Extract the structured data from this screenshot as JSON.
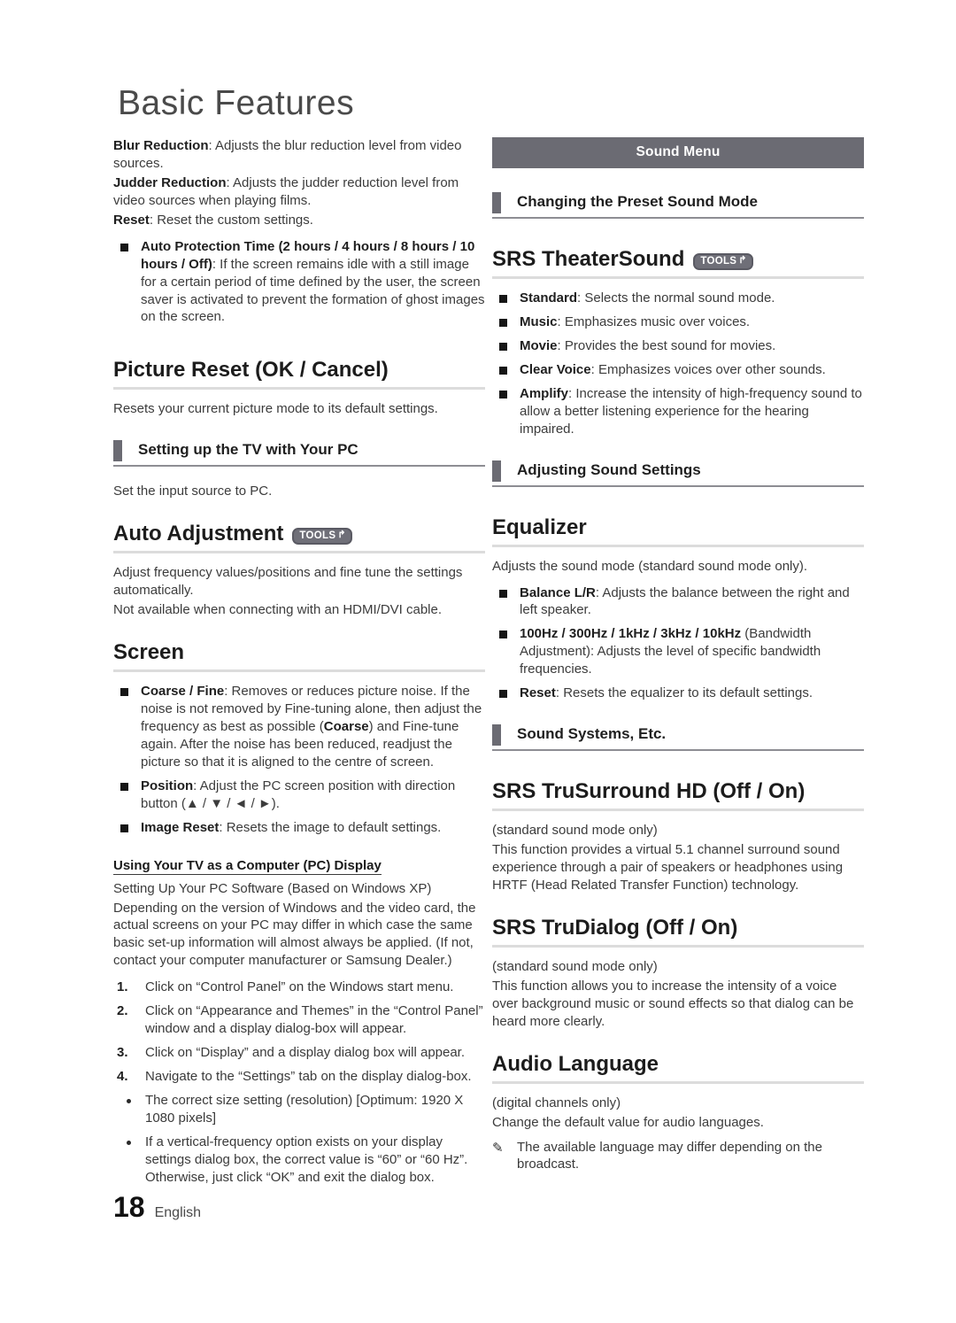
{
  "page": {
    "title": "Basic Features",
    "number": "18",
    "language": "English"
  },
  "badges": {
    "tools_label": "TOOLS",
    "tools_glyph": "↱"
  },
  "left_column": {
    "intro_paragraphs": [
      {
        "term": "Blur Reduction",
        "text": ": Adjusts the blur reduction level from video sources."
      },
      {
        "term": "Judder Reduction",
        "text": ": Adjusts the judder reduction level from video sources when playing films."
      },
      {
        "term": "Reset",
        "text": ": Reset the custom settings."
      }
    ],
    "auto_protection_bullet": {
      "term": "Auto Protection Time (2 hours / 4 hours / 8 hours / 10 hours / Off)",
      "text": ":  If the screen remains idle with a still image for a certain period of time defined by the user, the screen saver is activated to prevent the formation of ghost images on the screen."
    },
    "picture_reset": {
      "heading": "Picture Reset (OK / Cancel)",
      "body": "Resets your current picture mode to its default settings."
    },
    "setting_up_pc": {
      "subhead": "Setting up the TV with Your PC",
      "body": "Set the input source to PC."
    },
    "auto_adjustment": {
      "heading": "Auto Adjustment",
      "body1": "Adjust frequency values/positions and fine tune the settings automatically.",
      "body2": "Not available when connecting with an HDMI/DVI cable."
    },
    "screen": {
      "heading": "Screen",
      "bullets": [
        {
          "term": "Coarse / Fine",
          "text": ": Removes or reduces picture noise. If the noise is not removed by Fine-tuning alone, then adjust the frequency as best as possible (",
          "term2": "Coarse",
          "text2": ") and Fine-tune again. After the noise has been reduced, readjust the picture so that it is aligned to the centre of screen."
        },
        {
          "term": "Position",
          "text": ": Adjust the PC screen position with direction button (▲ / ▼ / ◄ / ►)."
        },
        {
          "term": "Image Reset",
          "text": ": Resets the image to default settings."
        }
      ]
    },
    "pc_display": {
      "underlined_heading": "Using Your TV as a Computer (PC) Display",
      "para1": "Setting Up Your PC Software (Based on Windows XP)",
      "para2": "Depending on the version of Windows and the video card, the actual screens on your PC may differ in which case the same basic set-up information will almost always be applied. (If not, contact your computer manufacturer or Samsung Dealer.)",
      "steps": [
        "Click on “Control Panel” on the Windows start menu.",
        "Click on “Appearance and Themes” in the “Control Panel” window and a display dialog-box will appear.",
        "Click on “Display” and a display dialog box will appear.",
        "Navigate to the “Settings” tab on the display dialog-box."
      ],
      "dots": [
        "The correct size setting (resolution) [Optimum: 1920 X 1080 pixels]",
        "If a vertical-frequency option exists on your display settings dialog box, the correct value is “60” or “60 Hz”. Otherwise, just click “OK” and exit the dialog box."
      ]
    }
  },
  "right_column": {
    "menu_banner": "Sound Menu",
    "preset_sound_mode": {
      "subhead": "Changing the Preset Sound Mode"
    },
    "srs_theatersound": {
      "heading": "SRS TheaterSound",
      "bullets": [
        {
          "term": "Standard",
          "text": ": Selects the normal sound mode."
        },
        {
          "term": "Music",
          "text": ": Emphasizes music over voices."
        },
        {
          "term": "Movie",
          "text": ": Provides the best sound for movies."
        },
        {
          "term": "Clear Voice",
          "text": ": Emphasizes voices over other sounds."
        },
        {
          "term": "Amplify",
          "text": ": Increase the intensity of high-frequency sound to allow a better listening experience for the hearing impaired."
        }
      ]
    },
    "adjusting_sound_settings": {
      "subhead": "Adjusting Sound Settings"
    },
    "equalizer": {
      "heading": "Equalizer",
      "body": "Adjusts the sound mode (standard sound mode only).",
      "bullets": [
        {
          "term": "Balance L/R",
          "text": ": Adjusts the balance between the right and left speaker."
        },
        {
          "term": "100Hz / 300Hz / 1kHz / 3kHz / 10kHz",
          "text": " (Bandwidth Adjustment): Adjusts the level of specific bandwidth frequencies."
        },
        {
          "term": "Reset",
          "text": ": Resets the equalizer to its default settings."
        }
      ]
    },
    "sound_systems": {
      "subhead": "Sound Systems, Etc."
    },
    "srs_trusurround": {
      "heading": "SRS TruSurround HD (Off / On)",
      "note": "(standard sound mode only)",
      "body": "This function provides a virtual 5.1 channel surround sound experience through a pair of speakers or headphones using HRTF (Head Related Transfer Function) technology."
    },
    "srs_trudialog": {
      "heading": "SRS TruDialog (Off / On)",
      "note": "(standard sound mode only)",
      "body": "This function allows you to increase the intensity of a voice over background music or sound effects so that dialog can be heard more clearly."
    },
    "audio_language": {
      "heading": "Audio Language",
      "note": "(digital channels only)",
      "body": "Change the default value for audio languages.",
      "pencil_note": "The available language may differ depending on the broadcast.",
      "pencil_glyph": "✎"
    }
  }
}
